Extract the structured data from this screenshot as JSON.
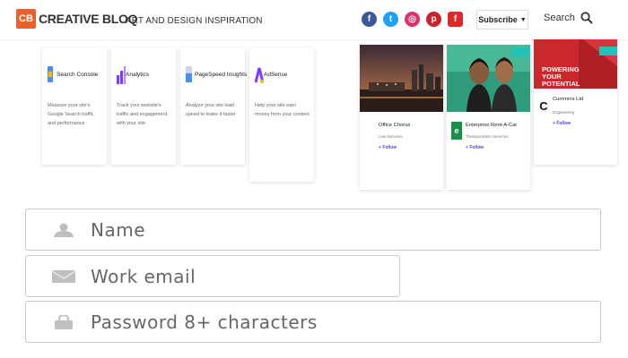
{
  "header": {
    "logo_badge": "CB",
    "logo_word": "CREATIVE BLOQ",
    "tagline": "ART AND DESIGN INSPIRATION",
    "socials": [
      {
        "name": "facebook",
        "glyph": "f",
        "color": "#3b5998"
      },
      {
        "name": "twitter",
        "glyph": "t",
        "color": "#1da1f2"
      },
      {
        "name": "instagram",
        "glyph": "◎",
        "color": "#e1306c"
      },
      {
        "name": "pinterest",
        "glyph": "p",
        "color": "#c8232c"
      },
      {
        "name": "flipboard",
        "glyph": "f",
        "color": "#e12828"
      }
    ],
    "subscribe_label": "Subscribe",
    "subscribe_caret": "▼",
    "search_label": "Search"
  },
  "products": [
    {
      "title": "Search Console",
      "desc": "Measure your site's Google Search traffic and performance",
      "icon_color": "#4a8cf6"
    },
    {
      "title": "Analytics",
      "desc": "Track your website's traffic and engagement with your site",
      "icon_color": "#7d3cff"
    },
    {
      "title": "PageSpeed Insights",
      "desc": "Analyze your site load speed to make it faster",
      "icon_color": "#4a8cf6"
    },
    {
      "title": "AdSense",
      "desc": "Help your site earn money from your content",
      "icon_color": "#7d3cff"
    }
  ],
  "companies": [
    {
      "name": "Office Chorus",
      "sub": "Law Services",
      "follow": "Follow",
      "meta1": "",
      "meta2": "",
      "tag": "",
      "logo": "",
      "logo_color": "#ffffff"
    },
    {
      "name": "Enterprise Rent-A-Car",
      "sub": "Transportation Services",
      "follow": "Follow",
      "meta1": "",
      "meta2": "",
      "tag": "",
      "logo": "e",
      "logo_color": "#16914a"
    },
    {
      "name": "Cummins Ltd",
      "sub": "Engineering",
      "follow": "Follow",
      "meta1": "",
      "meta2": "",
      "tag": "",
      "logo": "C",
      "logo_color": "#111111",
      "banner_text": "POWERING YOUR POTENTIAL"
    }
  ],
  "form": {
    "name_placeholder": "Name",
    "email_placeholder": "Work email",
    "password_placeholder": "Password 8+ characters"
  }
}
